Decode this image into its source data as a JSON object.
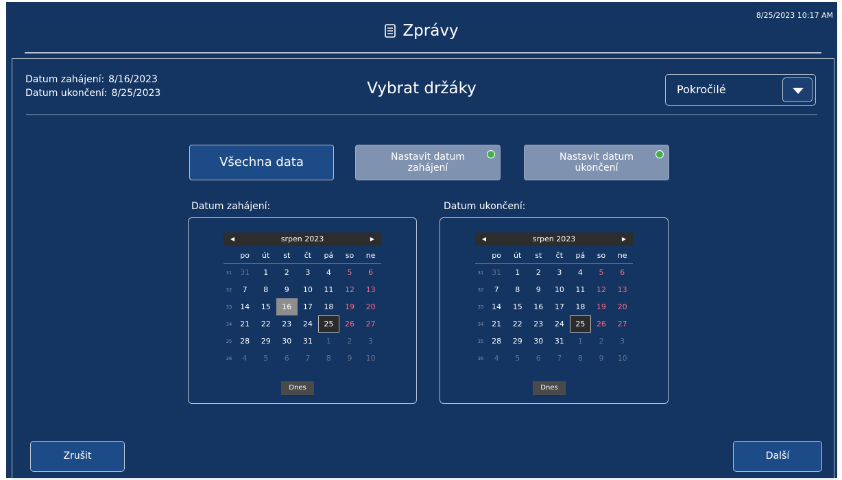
{
  "header": {
    "clock": "8/25/2023 10:17 AM",
    "title": "Zprávy",
    "title_icon": "report-document-icon"
  },
  "info": {
    "start_label": "Datum zahájení:",
    "start_value": "8/16/2023",
    "end_label": "Datum ukončení:",
    "end_value": "8/25/2023"
  },
  "section_title": "Vybrat držáky",
  "dropdown": {
    "value": "Pokročilé",
    "icon": "chevron-down-icon"
  },
  "modes": {
    "all": "Všechna data",
    "set_start_line1": "Nastavit datum",
    "set_start_line2": "zahájení",
    "set_end_line1": "Nastavit datum",
    "set_end_line2": "ukončení",
    "status_color": "#3fb24c"
  },
  "calendars": {
    "start": {
      "label": "Datum zahájení:",
      "month": "srpen 2023",
      "today_button": "Dnes",
      "selected_day": "16",
      "today_day": "25"
    },
    "end": {
      "label": "Datum ukončení:",
      "month": "srpen 2023",
      "today_button": "Dnes",
      "selected_day": "25",
      "today_day": "25"
    },
    "weekdays": [
      "po",
      "út",
      "st",
      "čt",
      "pá",
      "so",
      "ne"
    ],
    "weeks": [
      {
        "wk": "31",
        "days": [
          "31",
          "1",
          "2",
          "3",
          "4",
          "5",
          "6"
        ]
      },
      {
        "wk": "32",
        "days": [
          "7",
          "8",
          "9",
          "10",
          "11",
          "12",
          "13"
        ]
      },
      {
        "wk": "33",
        "days": [
          "14",
          "15",
          "16",
          "17",
          "18",
          "19",
          "20"
        ]
      },
      {
        "wk": "34",
        "days": [
          "21",
          "22",
          "23",
          "24",
          "25",
          "26",
          "27"
        ]
      },
      {
        "wk": "35",
        "days": [
          "28",
          "29",
          "30",
          "31",
          "1",
          "2",
          "3"
        ]
      },
      {
        "wk": "36",
        "days": [
          "4",
          "5",
          "6",
          "7",
          "8",
          "9",
          "10"
        ]
      }
    ]
  },
  "footer": {
    "cancel": "Zrušit",
    "next": "Další"
  },
  "colors": {
    "background": "#143461",
    "weekend": "#ff6d82",
    "button": "#1c4b87",
    "button_disabled": "#7f93b1"
  }
}
